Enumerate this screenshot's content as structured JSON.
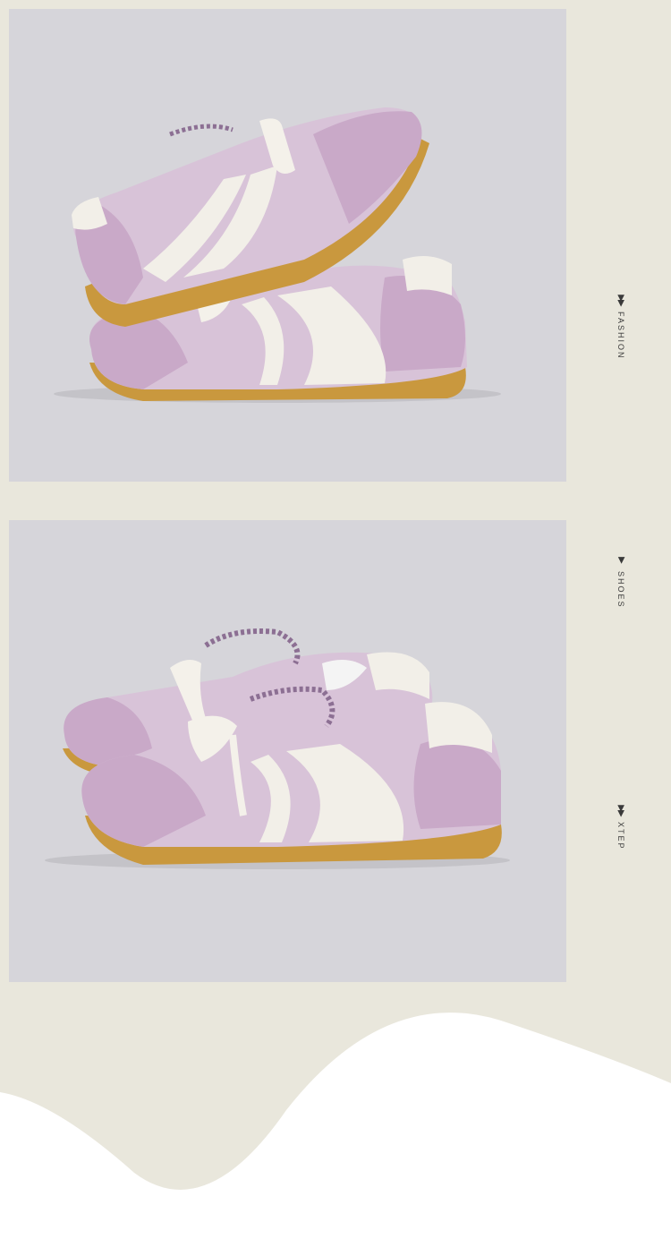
{
  "side_labels": [
    {
      "arrow": "▶▶",
      "text": "FASHION"
    },
    {
      "arrow": "▶",
      "text": "SHOES"
    },
    {
      "arrow": "▶▶",
      "text": "XTEP"
    }
  ],
  "colors": {
    "page_background": "#e9e7dc",
    "photo_background": "#d6d5da",
    "shoe_suede": "#c9a9c8",
    "shoe_body": "#d8c3d8",
    "shoe_accent": "#f2efe8",
    "sole": "#c9983e",
    "bottom_wave": "#ffffff"
  },
  "images": [
    {
      "name": "stacked-sneakers-photo",
      "subject": "two lilac and white sneakers stacked"
    },
    {
      "name": "paired-sneakers-photo",
      "subject": "pair of lilac and white sneakers side view"
    }
  ]
}
